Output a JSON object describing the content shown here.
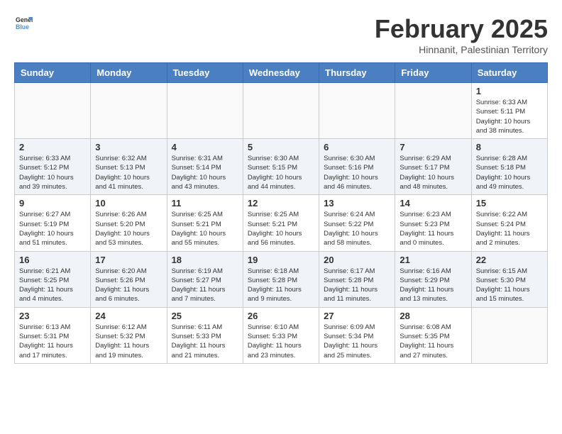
{
  "logo": {
    "line1": "General",
    "line2": "Blue"
  },
  "title": "February 2025",
  "subtitle": "Hinnanit, Palestinian Territory",
  "days_of_week": [
    "Sunday",
    "Monday",
    "Tuesday",
    "Wednesday",
    "Thursday",
    "Friday",
    "Saturday"
  ],
  "weeks": [
    [
      {
        "day": "",
        "info": ""
      },
      {
        "day": "",
        "info": ""
      },
      {
        "day": "",
        "info": ""
      },
      {
        "day": "",
        "info": ""
      },
      {
        "day": "",
        "info": ""
      },
      {
        "day": "",
        "info": ""
      },
      {
        "day": "1",
        "info": "Sunrise: 6:33 AM\nSunset: 5:11 PM\nDaylight: 10 hours\nand 38 minutes."
      }
    ],
    [
      {
        "day": "2",
        "info": "Sunrise: 6:33 AM\nSunset: 5:12 PM\nDaylight: 10 hours\nand 39 minutes."
      },
      {
        "day": "3",
        "info": "Sunrise: 6:32 AM\nSunset: 5:13 PM\nDaylight: 10 hours\nand 41 minutes."
      },
      {
        "day": "4",
        "info": "Sunrise: 6:31 AM\nSunset: 5:14 PM\nDaylight: 10 hours\nand 43 minutes."
      },
      {
        "day": "5",
        "info": "Sunrise: 6:30 AM\nSunset: 5:15 PM\nDaylight: 10 hours\nand 44 minutes."
      },
      {
        "day": "6",
        "info": "Sunrise: 6:30 AM\nSunset: 5:16 PM\nDaylight: 10 hours\nand 46 minutes."
      },
      {
        "day": "7",
        "info": "Sunrise: 6:29 AM\nSunset: 5:17 PM\nDaylight: 10 hours\nand 48 minutes."
      },
      {
        "day": "8",
        "info": "Sunrise: 6:28 AM\nSunset: 5:18 PM\nDaylight: 10 hours\nand 49 minutes."
      }
    ],
    [
      {
        "day": "9",
        "info": "Sunrise: 6:27 AM\nSunset: 5:19 PM\nDaylight: 10 hours\nand 51 minutes."
      },
      {
        "day": "10",
        "info": "Sunrise: 6:26 AM\nSunset: 5:20 PM\nDaylight: 10 hours\nand 53 minutes."
      },
      {
        "day": "11",
        "info": "Sunrise: 6:25 AM\nSunset: 5:21 PM\nDaylight: 10 hours\nand 55 minutes."
      },
      {
        "day": "12",
        "info": "Sunrise: 6:25 AM\nSunset: 5:21 PM\nDaylight: 10 hours\nand 56 minutes."
      },
      {
        "day": "13",
        "info": "Sunrise: 6:24 AM\nSunset: 5:22 PM\nDaylight: 10 hours\nand 58 minutes."
      },
      {
        "day": "14",
        "info": "Sunrise: 6:23 AM\nSunset: 5:23 PM\nDaylight: 11 hours\nand 0 minutes."
      },
      {
        "day": "15",
        "info": "Sunrise: 6:22 AM\nSunset: 5:24 PM\nDaylight: 11 hours\nand 2 minutes."
      }
    ],
    [
      {
        "day": "16",
        "info": "Sunrise: 6:21 AM\nSunset: 5:25 PM\nDaylight: 11 hours\nand 4 minutes."
      },
      {
        "day": "17",
        "info": "Sunrise: 6:20 AM\nSunset: 5:26 PM\nDaylight: 11 hours\nand 6 minutes."
      },
      {
        "day": "18",
        "info": "Sunrise: 6:19 AM\nSunset: 5:27 PM\nDaylight: 11 hours\nand 7 minutes."
      },
      {
        "day": "19",
        "info": "Sunrise: 6:18 AM\nSunset: 5:28 PM\nDaylight: 11 hours\nand 9 minutes."
      },
      {
        "day": "20",
        "info": "Sunrise: 6:17 AM\nSunset: 5:28 PM\nDaylight: 11 hours\nand 11 minutes."
      },
      {
        "day": "21",
        "info": "Sunrise: 6:16 AM\nSunset: 5:29 PM\nDaylight: 11 hours\nand 13 minutes."
      },
      {
        "day": "22",
        "info": "Sunrise: 6:15 AM\nSunset: 5:30 PM\nDaylight: 11 hours\nand 15 minutes."
      }
    ],
    [
      {
        "day": "23",
        "info": "Sunrise: 6:13 AM\nSunset: 5:31 PM\nDaylight: 11 hours\nand 17 minutes."
      },
      {
        "day": "24",
        "info": "Sunrise: 6:12 AM\nSunset: 5:32 PM\nDaylight: 11 hours\nand 19 minutes."
      },
      {
        "day": "25",
        "info": "Sunrise: 6:11 AM\nSunset: 5:33 PM\nDaylight: 11 hours\nand 21 minutes."
      },
      {
        "day": "26",
        "info": "Sunrise: 6:10 AM\nSunset: 5:33 PM\nDaylight: 11 hours\nand 23 minutes."
      },
      {
        "day": "27",
        "info": "Sunrise: 6:09 AM\nSunset: 5:34 PM\nDaylight: 11 hours\nand 25 minutes."
      },
      {
        "day": "28",
        "info": "Sunrise: 6:08 AM\nSunset: 5:35 PM\nDaylight: 11 hours\nand 27 minutes."
      },
      {
        "day": "",
        "info": ""
      }
    ]
  ]
}
